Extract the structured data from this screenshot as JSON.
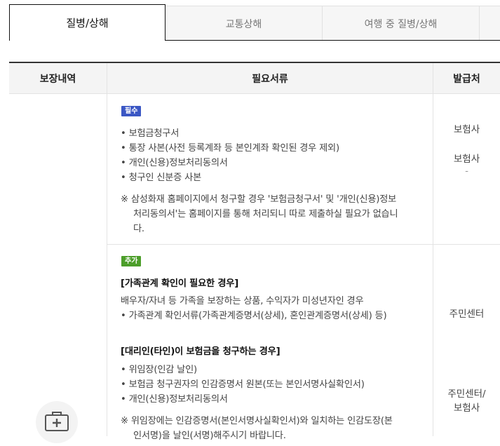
{
  "tabs": [
    {
      "label": "질병/상해",
      "active": true
    },
    {
      "label": "교통상해",
      "active": false
    },
    {
      "label": "여행 중 질병/상해",
      "active": false
    }
  ],
  "table": {
    "headers": [
      "보장내역",
      "필요서류",
      "발급처"
    ]
  },
  "required": {
    "badge": "필수",
    "items": [
      "• 보험금청구서",
      "• 통장 사본(사전 등록계좌 등 본인계좌 확인된 경우 제외)",
      "• 개인(신용)정보처리동의서",
      "• 청구인 신분증 사본"
    ],
    "note_lines": [
      "※ 삼성화재 홈페이지에서 청구할 경우 '보험금청구서' 및 '개인(신용)정보",
      "처리동의서'는 홈페이지를 통해 처리되니 따로 제출하실 필요가 없습니",
      "다."
    ],
    "issuers": [
      "보험사",
      "보험사",
      "-"
    ]
  },
  "additional": {
    "badge": "추가",
    "family": {
      "title": "[가족관계 확인이 필요한 경우]",
      "desc": "배우자/자녀 등 가족을 보장하는 상품, 수익자가 미성년자인 경우",
      "item": "• 가족관계 확인서류(가족관계증명서(상세), 혼인관계증명서(상세) 등)",
      "issuer": "주민센터"
    },
    "proxy": {
      "title": "[대리인(타인)이 보험금을 청구하는 경우]",
      "items": [
        "• 위임장(인감 날인)",
        "• 보험금 청구권자의 인감증명서 원본(또는 본인서명사실확인서)",
        "• 개인(신용)정보처리동의서"
      ],
      "note_lines": [
        "※ 위임장에는 인감증명서(본인서명사실확인서)와 일치하는 인감도장(본",
        "인서명)을 날인(서명)해주시기 바랍니다."
      ],
      "issuer_lines": [
        "주민센터/",
        "보험사"
      ]
    }
  },
  "icon": "medical-kit-icon"
}
